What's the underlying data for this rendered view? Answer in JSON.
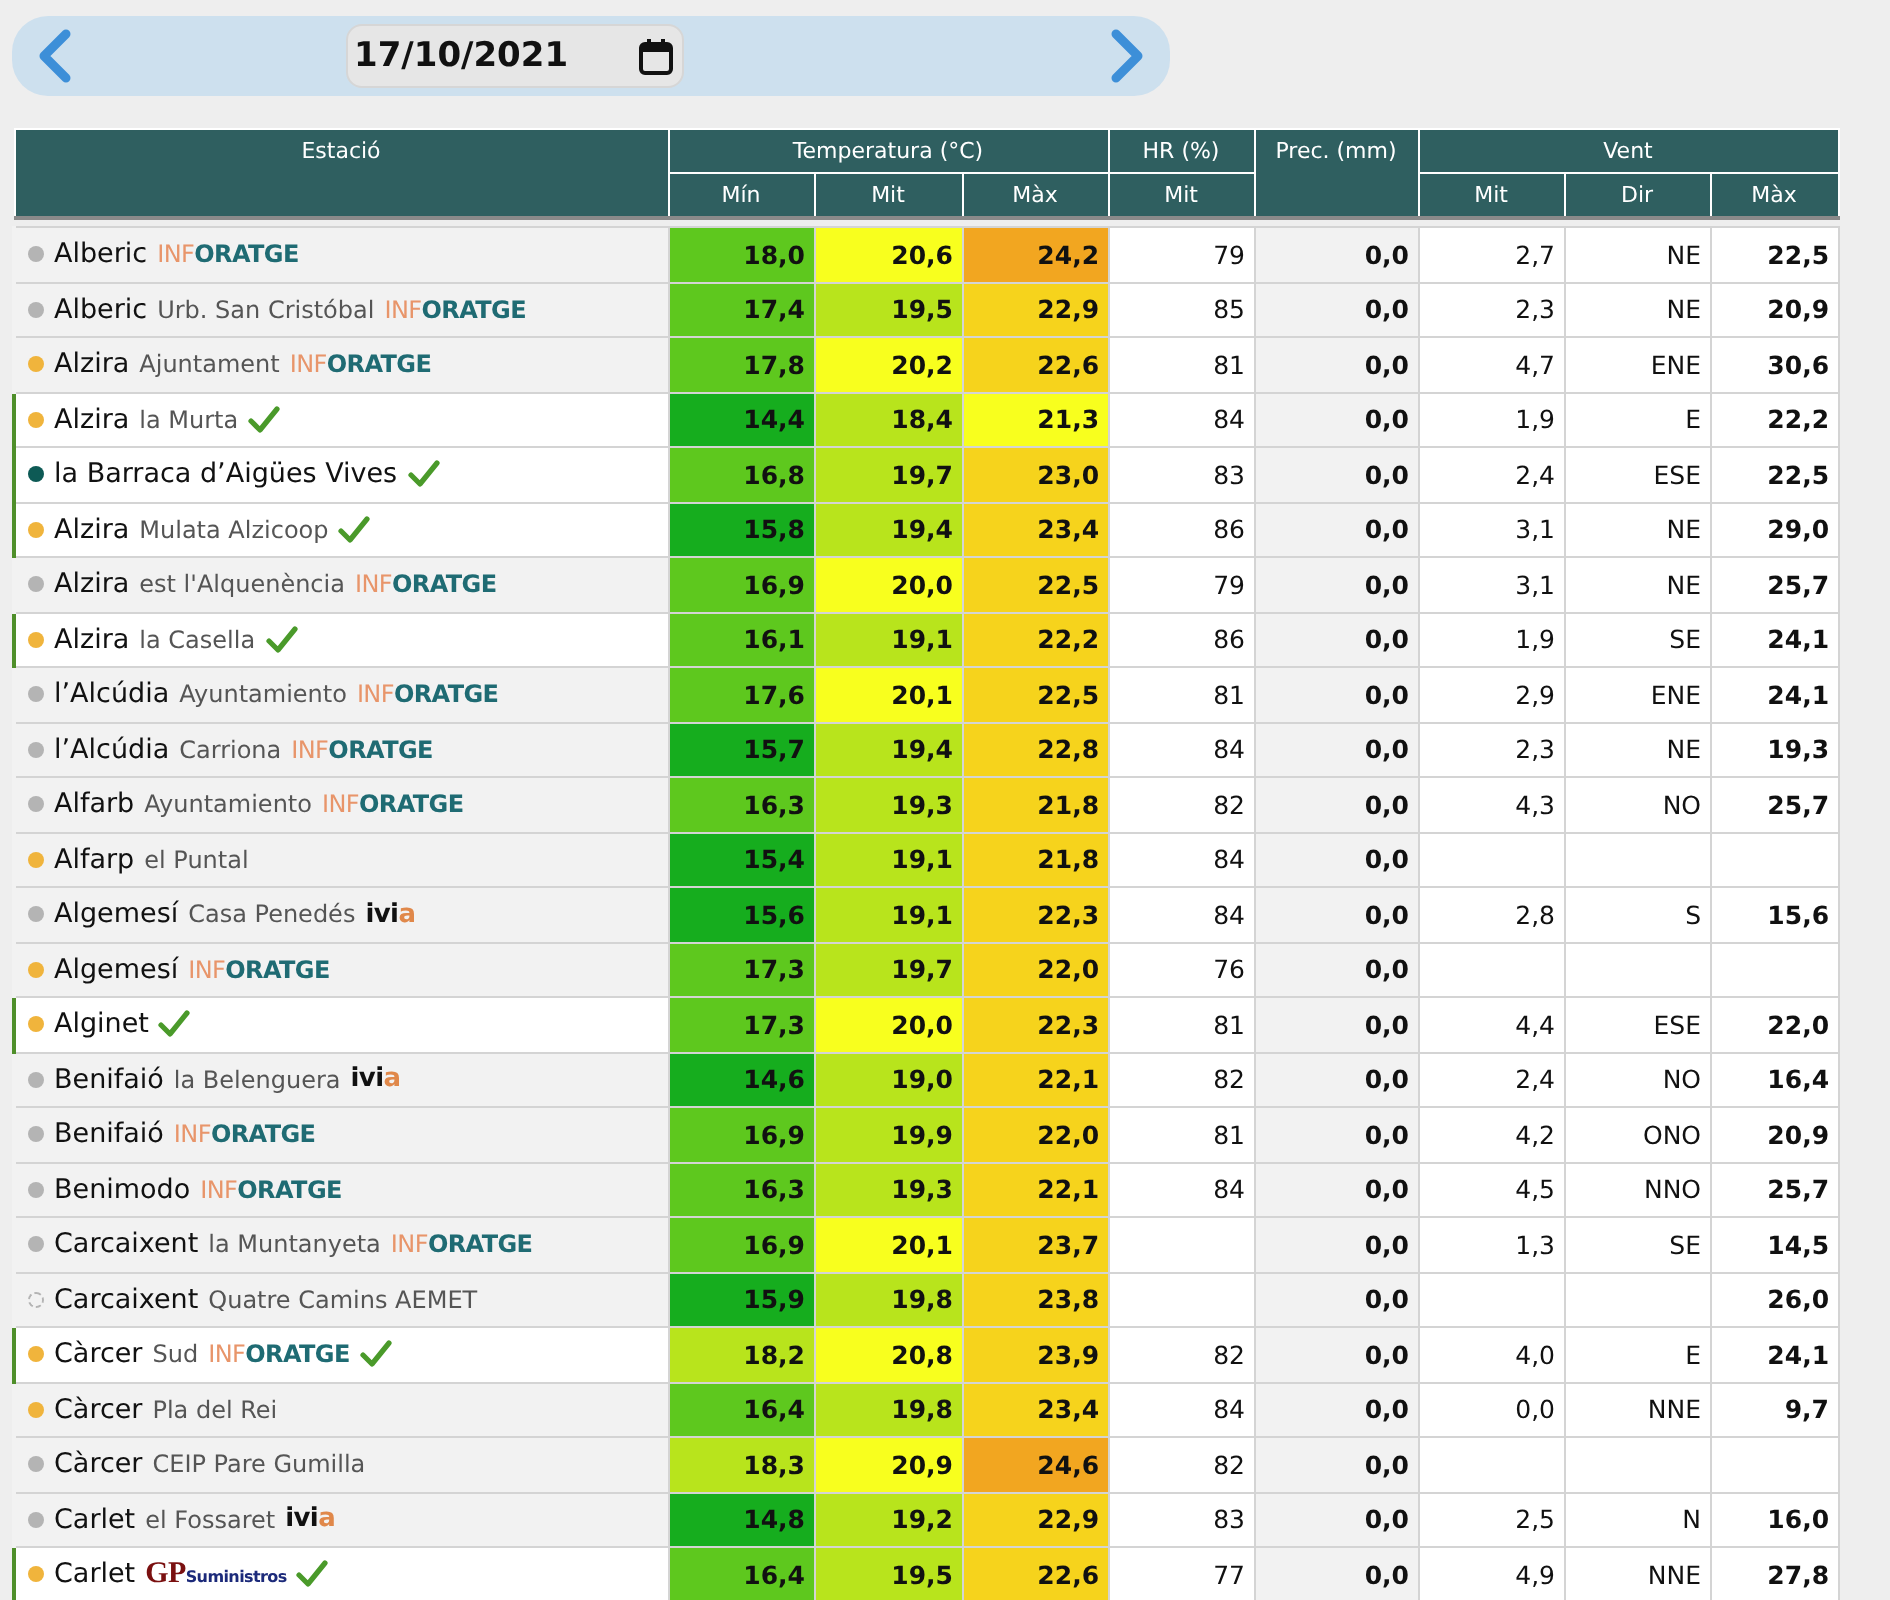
{
  "date_bar": {
    "date": "17/10/2021"
  },
  "table": {
    "columns": {
      "station": "Estació",
      "temperature": "Temperatura (°C)",
      "humidity": "HR (%)",
      "precipitation": "Prec. (mm)",
      "wind": "Vent",
      "temp_sub": [
        "Mín",
        "Mit",
        "Màx"
      ],
      "humidity_sub": [
        "Mit"
      ],
      "wind_sub": [
        "Mit",
        "Dir",
        "Màx"
      ]
    },
    "rows": [
      {
        "name": "Alberic",
        "logo": {
          "kind": "inforatge",
          "parts": [
            "INF",
            "ORATGE"
          ]
        },
        "dashed": false,
        "color": "#b4b4b4",
        "verified": false,
        "temps": [
          {
            "value": "18,0",
            "color": "#5ec81e"
          },
          {
            "value": "20,6",
            "color": "#f8ff1e"
          },
          {
            "value": "24,2",
            "color": "#f2a620"
          }
        ],
        "hr": "79",
        "prec": "0,0",
        "wind": {
          "mit": "2,7",
          "dir": "NE",
          "max": "22,5"
        }
      },
      {
        "name": "Alberic",
        "place": "Urb. San Cristóbal",
        "logo": {
          "kind": "inforatge",
          "parts": [
            "INF",
            "ORATGE"
          ]
        },
        "dashed": false,
        "color": "#b4b4b4",
        "verified": false,
        "temps": [
          {
            "value": "17,4",
            "color": "#5ec81e"
          },
          {
            "value": "19,5",
            "color": "#b8e41c"
          },
          {
            "value": "22,9",
            "color": "#f6d31c"
          }
        ],
        "hr": "85",
        "prec": "0,0",
        "wind": {
          "mit": "2,3",
          "dir": "NE",
          "max": "20,9"
        }
      },
      {
        "name": "Alzira",
        "place": "Ajuntament",
        "logo": {
          "kind": "inforatge",
          "parts": [
            "INF",
            "ORATGE"
          ]
        },
        "dashed": false,
        "color": "#f0b43c",
        "verified": false,
        "temps": [
          {
            "value": "17,8",
            "color": "#5ec81e"
          },
          {
            "value": "20,2",
            "color": "#f8ff1e"
          },
          {
            "value": "22,6",
            "color": "#f6d31c"
          }
        ],
        "hr": "81",
        "prec": "0,0",
        "wind": {
          "mit": "4,7",
          "dir": "ENE",
          "max": "30,6"
        }
      },
      {
        "name": "Alzira",
        "place": "la Murta",
        "dashed": false,
        "color": "#f0b43c",
        "verified": true,
        "temps": [
          {
            "value": "14,4",
            "color": "#16ad1e"
          },
          {
            "value": "18,4",
            "color": "#b8e41c"
          },
          {
            "value": "21,3",
            "color": "#f8ff1e"
          }
        ],
        "hr": "84",
        "prec": "0,0",
        "wind": {
          "mit": "1,9",
          "dir": "E",
          "max": "22,2"
        }
      },
      {
        "name": "la Barraca d’Aigües Vives",
        "dashed": false,
        "color": "#0d5a55",
        "verified": true,
        "temps": [
          {
            "value": "16,8",
            "color": "#5ec81e"
          },
          {
            "value": "19,7",
            "color": "#b8e41c"
          },
          {
            "value": "23,0",
            "color": "#f6d31c"
          }
        ],
        "hr": "83",
        "prec": "0,0",
        "wind": {
          "mit": "2,4",
          "dir": "ESE",
          "max": "22,5"
        }
      },
      {
        "name": "Alzira",
        "place": "Mulata Alzicoop",
        "dashed": false,
        "color": "#f0b43c",
        "verified": true,
        "temps": [
          {
            "value": "15,8",
            "color": "#16ad1e"
          },
          {
            "value": "19,4",
            "color": "#b8e41c"
          },
          {
            "value": "23,4",
            "color": "#f6d31c"
          }
        ],
        "hr": "86",
        "prec": "0,0",
        "wind": {
          "mit": "3,1",
          "dir": "NE",
          "max": "29,0"
        }
      },
      {
        "name": "Alzira",
        "place": "est l'Alquenència",
        "logo": {
          "kind": "inforatge",
          "parts": [
            "INF",
            "ORATGE"
          ]
        },
        "dashed": false,
        "color": "#b4b4b4",
        "verified": false,
        "temps": [
          {
            "value": "16,9",
            "color": "#5ec81e"
          },
          {
            "value": "20,0",
            "color": "#f8ff1e"
          },
          {
            "value": "22,5",
            "color": "#f6d31c"
          }
        ],
        "hr": "79",
        "prec": "0,0",
        "wind": {
          "mit": "3,1",
          "dir": "NE",
          "max": "25,7"
        }
      },
      {
        "name": "Alzira",
        "place": "la Casella",
        "dashed": false,
        "color": "#f0b43c",
        "verified": true,
        "temps": [
          {
            "value": "16,1",
            "color": "#5ec81e"
          },
          {
            "value": "19,1",
            "color": "#b8e41c"
          },
          {
            "value": "22,2",
            "color": "#f6d31c"
          }
        ],
        "hr": "86",
        "prec": "0,0",
        "wind": {
          "mit": "1,9",
          "dir": "SE",
          "max": "24,1"
        }
      },
      {
        "name": "l’Alcúdia",
        "place": "Ayuntamiento",
        "logo": {
          "kind": "inforatge",
          "parts": [
            "INF",
            "ORATGE"
          ]
        },
        "dashed": false,
        "color": "#b4b4b4",
        "verified": false,
        "temps": [
          {
            "value": "17,6",
            "color": "#5ec81e"
          },
          {
            "value": "20,1",
            "color": "#f8ff1e"
          },
          {
            "value": "22,5",
            "color": "#f6d31c"
          }
        ],
        "hr": "81",
        "prec": "0,0",
        "wind": {
          "mit": "2,9",
          "dir": "ENE",
          "max": "24,1"
        }
      },
      {
        "name": "l’Alcúdia",
        "place": "Carriona",
        "logo": {
          "kind": "inforatge",
          "parts": [
            "INF",
            "ORATGE"
          ]
        },
        "dashed": false,
        "color": "#b4b4b4",
        "verified": false,
        "temps": [
          {
            "value": "15,7",
            "color": "#16ad1e"
          },
          {
            "value": "19,4",
            "color": "#b8e41c"
          },
          {
            "value": "22,8",
            "color": "#f6d31c"
          }
        ],
        "hr": "84",
        "prec": "0,0",
        "wind": {
          "mit": "2,3",
          "dir": "NE",
          "max": "19,3"
        }
      },
      {
        "name": "Alfarb",
        "place": "Ayuntamiento",
        "logo": {
          "kind": "inforatge",
          "parts": [
            "INF",
            "ORATGE"
          ]
        },
        "dashed": false,
        "color": "#b4b4b4",
        "verified": false,
        "temps": [
          {
            "value": "16,3",
            "color": "#5ec81e"
          },
          {
            "value": "19,3",
            "color": "#b8e41c"
          },
          {
            "value": "21,8",
            "color": "#f6d31c"
          }
        ],
        "hr": "82",
        "prec": "0,0",
        "wind": {
          "mit": "4,3",
          "dir": "NO",
          "max": "25,7"
        }
      },
      {
        "name": "Alfarp",
        "place": "el Puntal",
        "dashed": false,
        "color": "#f0b43c",
        "verified": false,
        "temps": [
          {
            "value": "15,4",
            "color": "#16ad1e"
          },
          {
            "value": "19,1",
            "color": "#b8e41c"
          },
          {
            "value": "21,8",
            "color": "#f6d31c"
          }
        ],
        "hr": "84",
        "prec": "0,0",
        "wind": {}
      },
      {
        "name": "Algemesí",
        "place": "Casa Penedés",
        "logo": {
          "kind": "ivia",
          "parts": [
            "ivi",
            "a"
          ]
        },
        "dashed": false,
        "color": "#b4b4b4",
        "verified": false,
        "temps": [
          {
            "value": "15,6",
            "color": "#16ad1e"
          },
          {
            "value": "19,1",
            "color": "#b8e41c"
          },
          {
            "value": "22,3",
            "color": "#f6d31c"
          }
        ],
        "hr": "84",
        "prec": "0,0",
        "wind": {
          "mit": "2,8",
          "dir": "S",
          "max": "15,6"
        }
      },
      {
        "name": "Algemesí",
        "logo": {
          "kind": "inforatge",
          "parts": [
            "INF",
            "ORATGE"
          ]
        },
        "dashed": false,
        "color": "#f0b43c",
        "verified": false,
        "temps": [
          {
            "value": "17,3",
            "color": "#5ec81e"
          },
          {
            "value": "19,7",
            "color": "#b8e41c"
          },
          {
            "value": "22,0",
            "color": "#f6d31c"
          }
        ],
        "hr": "76",
        "prec": "0,0",
        "wind": {}
      },
      {
        "name": "Alginet",
        "dashed": false,
        "color": "#f0b43c",
        "verified": true,
        "temps": [
          {
            "value": "17,3",
            "color": "#5ec81e"
          },
          {
            "value": "20,0",
            "color": "#f8ff1e"
          },
          {
            "value": "22,3",
            "color": "#f6d31c"
          }
        ],
        "hr": "81",
        "prec": "0,0",
        "wind": {
          "mit": "4,4",
          "dir": "ESE",
          "max": "22,0"
        }
      },
      {
        "name": "Benifaió",
        "place": "la Belenguera",
        "logo": {
          "kind": "ivia",
          "parts": [
            "ivi",
            "a"
          ]
        },
        "dashed": false,
        "color": "#b4b4b4",
        "verified": false,
        "temps": [
          {
            "value": "14,6",
            "color": "#16ad1e"
          },
          {
            "value": "19,0",
            "color": "#b8e41c"
          },
          {
            "value": "22,1",
            "color": "#f6d31c"
          }
        ],
        "hr": "82",
        "prec": "0,0",
        "wind": {
          "mit": "2,4",
          "dir": "NO",
          "max": "16,4"
        }
      },
      {
        "name": "Benifaió",
        "logo": {
          "kind": "inforatge",
          "parts": [
            "INF",
            "ORATGE"
          ]
        },
        "dashed": false,
        "color": "#b4b4b4",
        "verified": false,
        "temps": [
          {
            "value": "16,9",
            "color": "#5ec81e"
          },
          {
            "value": "19,9",
            "color": "#b8e41c"
          },
          {
            "value": "22,0",
            "color": "#f6d31c"
          }
        ],
        "hr": "81",
        "prec": "0,0",
        "wind": {
          "mit": "4,2",
          "dir": "ONO",
          "max": "20,9"
        }
      },
      {
        "name": "Benimodo",
        "logo": {
          "kind": "inforatge",
          "parts": [
            "INF",
            "ORATGE"
          ]
        },
        "dashed": false,
        "color": "#b4b4b4",
        "verified": false,
        "temps": [
          {
            "value": "16,3",
            "color": "#5ec81e"
          },
          {
            "value": "19,3",
            "color": "#b8e41c"
          },
          {
            "value": "22,1",
            "color": "#f6d31c"
          }
        ],
        "hr": "84",
        "prec": "0,0",
        "wind": {
          "mit": "4,5",
          "dir": "NNO",
          "max": "25,7"
        }
      },
      {
        "name": "Carcaixent",
        "place": "la Muntanyeta",
        "logo": {
          "kind": "inforatge",
          "parts": [
            "INF",
            "ORATGE"
          ]
        },
        "dashed": false,
        "color": "#b4b4b4",
        "verified": false,
        "temps": [
          {
            "value": "16,9",
            "color": "#5ec81e"
          },
          {
            "value": "20,1",
            "color": "#f8ff1e"
          },
          {
            "value": "23,7",
            "color": "#f6d31c"
          }
        ],
        "prec": "0,0",
        "wind": {
          "mit": "1,3",
          "dir": "SE",
          "max": "14,5"
        }
      },
      {
        "name": "Carcaixent",
        "place": "Quatre Camins AEMET",
        "dashed": true,
        "color": "#b4b4b4",
        "verified": false,
        "temps": [
          {
            "value": "15,9",
            "color": "#16ad1e"
          },
          {
            "value": "19,8",
            "color": "#b8e41c"
          },
          {
            "value": "23,8",
            "color": "#f6d31c"
          }
        ],
        "prec": "0,0",
        "wind": {
          "max": "26,0"
        }
      },
      {
        "name": "Càrcer",
        "place": "Sud",
        "logo": {
          "kind": "inforatge",
          "parts": [
            "INF",
            "ORATGE"
          ]
        },
        "dashed": false,
        "color": "#f0b43c",
        "verified": true,
        "temps": [
          {
            "value": "18,2",
            "color": "#b8e41c"
          },
          {
            "value": "20,8",
            "color": "#f8ff1e"
          },
          {
            "value": "23,9",
            "color": "#f6d31c"
          }
        ],
        "hr": "82",
        "prec": "0,0",
        "wind": {
          "mit": "4,0",
          "dir": "E",
          "max": "24,1"
        }
      },
      {
        "name": "Càrcer",
        "place": "Pla del Rei",
        "dashed": false,
        "color": "#f0b43c",
        "verified": false,
        "temps": [
          {
            "value": "16,4",
            "color": "#5ec81e"
          },
          {
            "value": "19,8",
            "color": "#b8e41c"
          },
          {
            "value": "23,4",
            "color": "#f6d31c"
          }
        ],
        "hr": "84",
        "prec": "0,0",
        "wind": {
          "mit": "0,0",
          "dir": "NNE",
          "max": "9,7"
        }
      },
      {
        "name": "Càrcer",
        "place": "CEIP Pare Gumilla",
        "dashed": false,
        "color": "#b4b4b4",
        "verified": false,
        "temps": [
          {
            "value": "18,3",
            "color": "#b8e41c"
          },
          {
            "value": "20,9",
            "color": "#f8ff1e"
          },
          {
            "value": "24,6",
            "color": "#f2a620"
          }
        ],
        "hr": "82",
        "prec": "0,0",
        "wind": {}
      },
      {
        "name": "Carlet",
        "place": "el Fossaret",
        "logo": {
          "kind": "ivia",
          "parts": [
            "ivi",
            "a"
          ]
        },
        "dashed": false,
        "color": "#b4b4b4",
        "verified": false,
        "temps": [
          {
            "value": "14,8",
            "color": "#16ad1e"
          },
          {
            "value": "19,2",
            "color": "#b8e41c"
          },
          {
            "value": "22,9",
            "color": "#f6d31c"
          }
        ],
        "hr": "83",
        "prec": "0,0",
        "wind": {
          "mit": "2,5",
          "dir": "N",
          "max": "16,0"
        }
      },
      {
        "name": "Carlet",
        "logo": {
          "kind": "gp",
          "parts": [
            "GP",
            "Suministros"
          ]
        },
        "dashed": false,
        "color": "#f0b43c",
        "verified": true,
        "temps": [
          {
            "value": "16,4",
            "color": "#5ec81e"
          },
          {
            "value": "19,5",
            "color": "#b8e41c"
          },
          {
            "value": "22,6",
            "color": "#f6d31c"
          }
        ],
        "hr": "77",
        "prec": "0,0",
        "wind": {
          "mit": "4,9",
          "dir": "NNE",
          "max": "27,8"
        }
      }
    ]
  }
}
